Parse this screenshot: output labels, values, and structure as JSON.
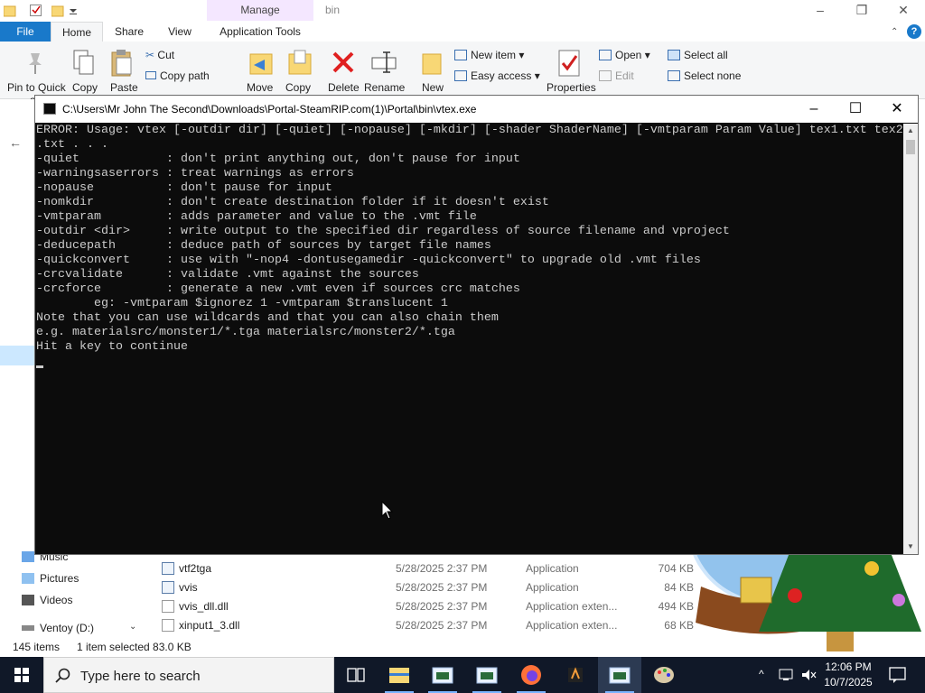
{
  "explorer": {
    "title_path": "bin",
    "manage_tab": "Manage",
    "tabs": [
      "File",
      "Home",
      "Share",
      "View",
      "Application Tools"
    ],
    "ribbon": {
      "pin_to_quick_access": "Pin to Quick",
      "pin_to_quick_access_2": "acc",
      "copy": "Copy",
      "paste": "Paste",
      "cut": "Cut",
      "copy_path": "Copy path",
      "move_to": "Move",
      "copy_to": "Copy",
      "delete": "Delete",
      "rename": "Rename",
      "new_folder": "New",
      "new_item": "New item",
      "easy_access": "Easy access",
      "properties": "Properties",
      "open": "Open",
      "edit": "Edit",
      "select_all": "Select all",
      "select_none": "Select none"
    },
    "nav": [
      {
        "label": "Music",
        "icon": "music-icon"
      },
      {
        "label": "Pictures",
        "icon": "pictures-icon"
      },
      {
        "label": "Videos",
        "icon": "videos-icon"
      },
      {
        "label": "Ventoy (D:)",
        "icon": "drive-icon"
      }
    ],
    "files": [
      {
        "name": "vtf2tga",
        "date": "5/28/2025 2:37 PM",
        "type": "Application",
        "size": "704 KB"
      },
      {
        "name": "vvis",
        "date": "5/28/2025 2:37 PM",
        "type": "Application",
        "size": "84 KB"
      },
      {
        "name": "vvis_dll.dll",
        "date": "5/28/2025 2:37 PM",
        "type": "Application exten...",
        "size": "494 KB"
      },
      {
        "name": "xinput1_3.dll",
        "date": "5/28/2025 2:37 PM",
        "type": "Application exten...",
        "size": "68 KB"
      }
    ],
    "status": {
      "item_count": "145 items",
      "selection": "1 item selected  83.0 KB"
    }
  },
  "console": {
    "title": "C:\\Users\\Mr John The Second\\Downloads\\Portal-SteamRIP.com(1)\\Portal\\bin\\vtex.exe",
    "lines": [
      "ERROR: Usage: vtex [-outdir dir] [-quiet] [-nopause] [-mkdir] [-shader ShaderName] [-vmtparam Param Value] tex1.txt tex2",
      ".txt . . .",
      "-quiet            : don't print anything out, don't pause for input",
      "-warningsaserrors : treat warnings as errors",
      "-nopause          : don't pause for input",
      "-nomkdir          : don't create destination folder if it doesn't exist",
      "-vmtparam         : adds parameter and value to the .vmt file",
      "-outdir <dir>     : write output to the specified dir regardless of source filename and vproject",
      "-deducepath       : deduce path of sources by target file names",
      "-quickconvert     : use with \"-nop4 -dontusegamedir -quickconvert\" to upgrade old .vmt files",
      "-crcvalidate      : validate .vmt against the sources",
      "-crcforce         : generate a new .vmt even if sources crc matches",
      "        eg: -vmtparam $ignorez 1 -vmtparam $translucent 1",
      "Note that you can use wildcards and that you can also chain them",
      "e.g. materialsrc/monster1/*.tga materialsrc/monster2/*.tga",
      "Hit a key to continue"
    ]
  },
  "taskbar": {
    "search_placeholder": "Type here to search",
    "time": "12:06 PM",
    "date": "10/7/2025",
    "apps": [
      "task-view-icon",
      "file-explorer-icon",
      "console-app-icon",
      "console-app-icon",
      "firefox-icon",
      "game-app-icon",
      "console-app-icon",
      "paint-icon"
    ]
  },
  "colors": {
    "console_bg": "#0c0c0c",
    "console_text": "#cccccc",
    "file_tab": "#1979ca",
    "manage_tab": "#f4e7ff",
    "taskbar": "#101828"
  }
}
